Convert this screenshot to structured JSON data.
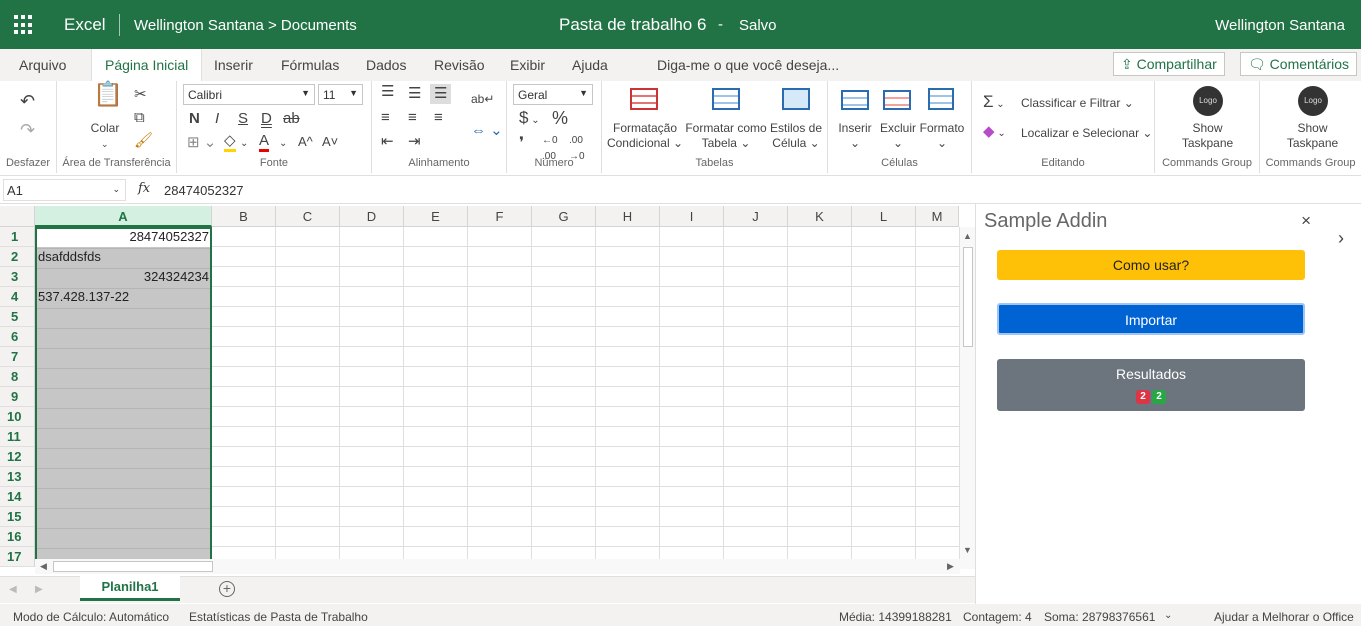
{
  "titlebar": {
    "app": "Excel",
    "breadcrumb": "Wellington Santana > Documents",
    "doc_title": "Pasta de trabalho 6",
    "separator": "-",
    "save_status": "Salvo",
    "user": "Wellington Santana"
  },
  "tabs": [
    "Arquivo",
    "Página Inicial",
    "Inserir",
    "Fórmulas",
    "Dados",
    "Revisão",
    "Exibir",
    "Ajuda"
  ],
  "active_tab": "Página Inicial",
  "tell_me": "Diga-me o que você deseja...",
  "share": "Compartilhar",
  "comments": "Comentários",
  "ribbon": {
    "undo_group": "Desfazer",
    "clipboard": {
      "paste": "Colar",
      "group": "Área de Transferência"
    },
    "font": {
      "name": "Calibri",
      "size": "11",
      "bold": "N",
      "italic": "I",
      "underline": "S",
      "dunder": "D",
      "strike": "ab",
      "grow": "A^",
      "shrink": "A˅",
      "group": "Fonte"
    },
    "alignment": {
      "group": "Alinhamento"
    },
    "number": {
      "format": "Geral",
      "currency": "$",
      "percent": "%",
      "group": "Número"
    },
    "tables": {
      "cond": "Formatação Condicional",
      "cond1": "Formatação",
      "cond2": "Condicional",
      "fmt1": "Formatar como",
      "fmt2": "Tabela",
      "styles1": "Estilos de",
      "styles2": "Célula",
      "group": "Tabelas"
    },
    "cells": {
      "insert": "Inserir",
      "delete": "Excluir",
      "format": "Formato",
      "group": "Células"
    },
    "editing": {
      "sort": "Classificar e Filtrar",
      "find": "Localizar e Selecionar",
      "sigma": "Σ",
      "group": "Editando"
    },
    "cmd1": {
      "logo": "Logo",
      "label1": "Show",
      "label2": "Taskpane",
      "group": "Commands Group"
    },
    "cmd2": {
      "logo": "Logo",
      "label1": "Show",
      "label2": "Taskpane",
      "group": "Commands Group"
    }
  },
  "formula_bar": {
    "name_box": "A1",
    "fx": "fx",
    "value": "28474052327"
  },
  "columns": [
    "A",
    "B",
    "C",
    "D",
    "E",
    "F",
    "G",
    "H",
    "I",
    "J",
    "K",
    "L",
    "M"
  ],
  "rows": [
    "1",
    "2",
    "3",
    "4",
    "5",
    "6",
    "7",
    "8",
    "9",
    "10",
    "11",
    "12",
    "13",
    "14",
    "15",
    "16",
    "17"
  ],
  "cells": {
    "A1": "28474052327",
    "A2": "dsafddsfds",
    "A3": "324324234",
    "A4": "537.428.137-22"
  },
  "taskpane": {
    "title": "Sample Addin",
    "close": "×",
    "how_to": "Como usar?",
    "import": "Importar",
    "results": "Resultados",
    "badge_red": "2",
    "badge_green": "2",
    "colors": {
      "how_to": "#ffc107",
      "import": "#0063d3",
      "results": "#6c757d",
      "red": "#dc3545",
      "green": "#28a745"
    }
  },
  "sheet_tab": "Planilha1",
  "status": {
    "calc_mode": "Modo de Cálculo: Automático",
    "stats": "Estatísticas de Pasta de Trabalho",
    "average": "Média: 14399188281",
    "count": "Contagem: 4",
    "sum": "Soma: 28798376561",
    "help": "Ajudar a Melhorar o Office"
  },
  "accent": "#217346"
}
